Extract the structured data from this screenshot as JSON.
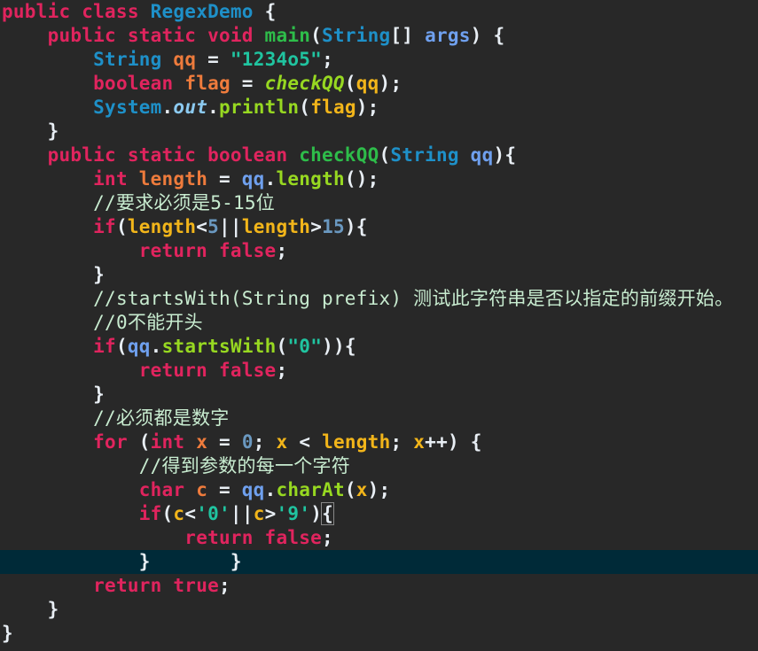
{
  "editor": {
    "language": "java",
    "current_line": 24,
    "lines": [
      [
        {
          "t": "kw",
          "v": "public class "
        },
        {
          "t": "cls",
          "v": "RegexDemo"
        },
        {
          "t": "pun",
          "v": " {"
        }
      ],
      [
        {
          "t": "pun",
          "v": "    "
        },
        {
          "t": "kw",
          "v": "public static void "
        },
        {
          "t": "fn",
          "v": "main"
        },
        {
          "t": "pun",
          "v": "("
        },
        {
          "t": "cls",
          "v": "String"
        },
        {
          "t": "pun",
          "v": "[] "
        },
        {
          "t": "param",
          "v": "args"
        },
        {
          "t": "pun",
          "v": ") {"
        }
      ],
      [
        {
          "t": "pun",
          "v": "        "
        },
        {
          "t": "cls",
          "v": "String "
        },
        {
          "t": "var",
          "v": "qq"
        },
        {
          "t": "pun",
          "v": " = "
        },
        {
          "t": "str",
          "v": "\"1234o5\""
        },
        {
          "t": "pun",
          "v": ";"
        }
      ],
      [
        {
          "t": "pun",
          "v": "        "
        },
        {
          "t": "kw",
          "v": "boolean "
        },
        {
          "t": "var",
          "v": "flag"
        },
        {
          "t": "pun",
          "v": " = "
        },
        {
          "t": "mth it",
          "v": "checkQQ"
        },
        {
          "t": "pun",
          "v": "("
        },
        {
          "t": "loc",
          "v": "qq"
        },
        {
          "t": "pun",
          "v": ");"
        }
      ],
      [
        {
          "t": "pun",
          "v": "        "
        },
        {
          "t": "cls",
          "v": "System"
        },
        {
          "t": "pun",
          "v": "."
        },
        {
          "t": "out",
          "v": "out"
        },
        {
          "t": "pun",
          "v": "."
        },
        {
          "t": "mth",
          "v": "println"
        },
        {
          "t": "pun",
          "v": "("
        },
        {
          "t": "loc",
          "v": "flag"
        },
        {
          "t": "pun",
          "v": ");"
        }
      ],
      [
        {
          "t": "pun",
          "v": "    }"
        }
      ],
      [
        {
          "t": "pun",
          "v": "    "
        },
        {
          "t": "kw",
          "v": "public static boolean "
        },
        {
          "t": "fn",
          "v": "checkQQ"
        },
        {
          "t": "pun",
          "v": "("
        },
        {
          "t": "cls",
          "v": "String "
        },
        {
          "t": "param",
          "v": "qq"
        },
        {
          "t": "pun",
          "v": "){"
        }
      ],
      [
        {
          "t": "pun",
          "v": "        "
        },
        {
          "t": "kw",
          "v": "int "
        },
        {
          "t": "var",
          "v": "length"
        },
        {
          "t": "pun",
          "v": " = "
        },
        {
          "t": "param",
          "v": "qq"
        },
        {
          "t": "pun",
          "v": "."
        },
        {
          "t": "mth",
          "v": "length"
        },
        {
          "t": "pun",
          "v": "();"
        }
      ],
      [
        {
          "t": "pun",
          "v": "        "
        },
        {
          "t": "cmt",
          "v": "//要求必须是5-15位"
        }
      ],
      [
        {
          "t": "pun",
          "v": "        "
        },
        {
          "t": "kw",
          "v": "if"
        },
        {
          "t": "pun",
          "v": "("
        },
        {
          "t": "loc",
          "v": "length"
        },
        {
          "t": "pun",
          "v": "<"
        },
        {
          "t": "num",
          "v": "5"
        },
        {
          "t": "pun",
          "v": "||"
        },
        {
          "t": "loc",
          "v": "length"
        },
        {
          "t": "pun",
          "v": ">"
        },
        {
          "t": "num",
          "v": "15"
        },
        {
          "t": "pun",
          "v": "){"
        }
      ],
      [
        {
          "t": "pun",
          "v": "            "
        },
        {
          "t": "kw",
          "v": "return false"
        },
        {
          "t": "pun",
          "v": ";"
        }
      ],
      [
        {
          "t": "pun",
          "v": "        }"
        }
      ],
      [
        {
          "t": "pun",
          "v": "        "
        },
        {
          "t": "cmt",
          "v": "//startsWith(String prefix) 测试此字符串是否以指定的前缀开始。"
        }
      ],
      [
        {
          "t": "pun",
          "v": "        "
        },
        {
          "t": "cmt",
          "v": "//0不能开头"
        }
      ],
      [
        {
          "t": "pun",
          "v": "        "
        },
        {
          "t": "kw",
          "v": "if"
        },
        {
          "t": "pun",
          "v": "("
        },
        {
          "t": "param",
          "v": "qq"
        },
        {
          "t": "pun",
          "v": "."
        },
        {
          "t": "mth",
          "v": "startsWith"
        },
        {
          "t": "pun",
          "v": "("
        },
        {
          "t": "str",
          "v": "\"0\""
        },
        {
          "t": "pun",
          "v": ")){"
        }
      ],
      [
        {
          "t": "pun",
          "v": "            "
        },
        {
          "t": "kw",
          "v": "return false"
        },
        {
          "t": "pun",
          "v": ";"
        }
      ],
      [
        {
          "t": "pun",
          "v": "        }"
        }
      ],
      [
        {
          "t": "pun",
          "v": "        "
        },
        {
          "t": "cmt",
          "v": "//必须都是数字"
        }
      ],
      [
        {
          "t": "pun",
          "v": "        "
        },
        {
          "t": "kw",
          "v": "for "
        },
        {
          "t": "pun",
          "v": "("
        },
        {
          "t": "kw",
          "v": "int "
        },
        {
          "t": "var",
          "v": "x"
        },
        {
          "t": "pun",
          "v": " = "
        },
        {
          "t": "num",
          "v": "0"
        },
        {
          "t": "pun",
          "v": "; "
        },
        {
          "t": "loc",
          "v": "x"
        },
        {
          "t": "pun",
          "v": " < "
        },
        {
          "t": "loc",
          "v": "length"
        },
        {
          "t": "pun",
          "v": "; "
        },
        {
          "t": "loc",
          "v": "x"
        },
        {
          "t": "pun",
          "v": "++) {"
        }
      ],
      [
        {
          "t": "pun",
          "v": "            "
        },
        {
          "t": "cmt",
          "v": "//得到参数的每一个字符"
        }
      ],
      [
        {
          "t": "pun",
          "v": "            "
        },
        {
          "t": "kw",
          "v": "char "
        },
        {
          "t": "var",
          "v": "c"
        },
        {
          "t": "pun",
          "v": " = "
        },
        {
          "t": "param",
          "v": "qq"
        },
        {
          "t": "pun",
          "v": "."
        },
        {
          "t": "mth",
          "v": "charAt"
        },
        {
          "t": "pun",
          "v": "("
        },
        {
          "t": "loc",
          "v": "x"
        },
        {
          "t": "pun",
          "v": ");"
        }
      ],
      [
        {
          "t": "pun",
          "v": "            "
        },
        {
          "t": "kw",
          "v": "if"
        },
        {
          "t": "pun",
          "v": "("
        },
        {
          "t": "loc",
          "v": "c"
        },
        {
          "t": "pun",
          "v": "<"
        },
        {
          "t": "str",
          "v": "'0'"
        },
        {
          "t": "pun",
          "v": "||"
        },
        {
          "t": "loc",
          "v": "c"
        },
        {
          "t": "pun",
          "v": ">"
        },
        {
          "t": "str",
          "v": "'9'"
        },
        {
          "t": "pun",
          "v": ")"
        },
        {
          "t": "pun caret",
          "v": "{"
        }
      ],
      [
        {
          "t": "pun",
          "v": "                "
        },
        {
          "t": "kw",
          "v": "return false"
        },
        {
          "t": "pun",
          "v": ";"
        }
      ],
      [
        {
          "t": "pun",
          "v": "            }       }"
        }
      ],
      [
        {
          "t": "pun",
          "v": "        "
        },
        {
          "t": "kw",
          "v": "return true"
        },
        {
          "t": "pun",
          "v": ";"
        }
      ],
      [
        {
          "t": "pun",
          "v": "    }"
        }
      ],
      [
        {
          "t": "pun",
          "v": "}"
        }
      ]
    ]
  }
}
